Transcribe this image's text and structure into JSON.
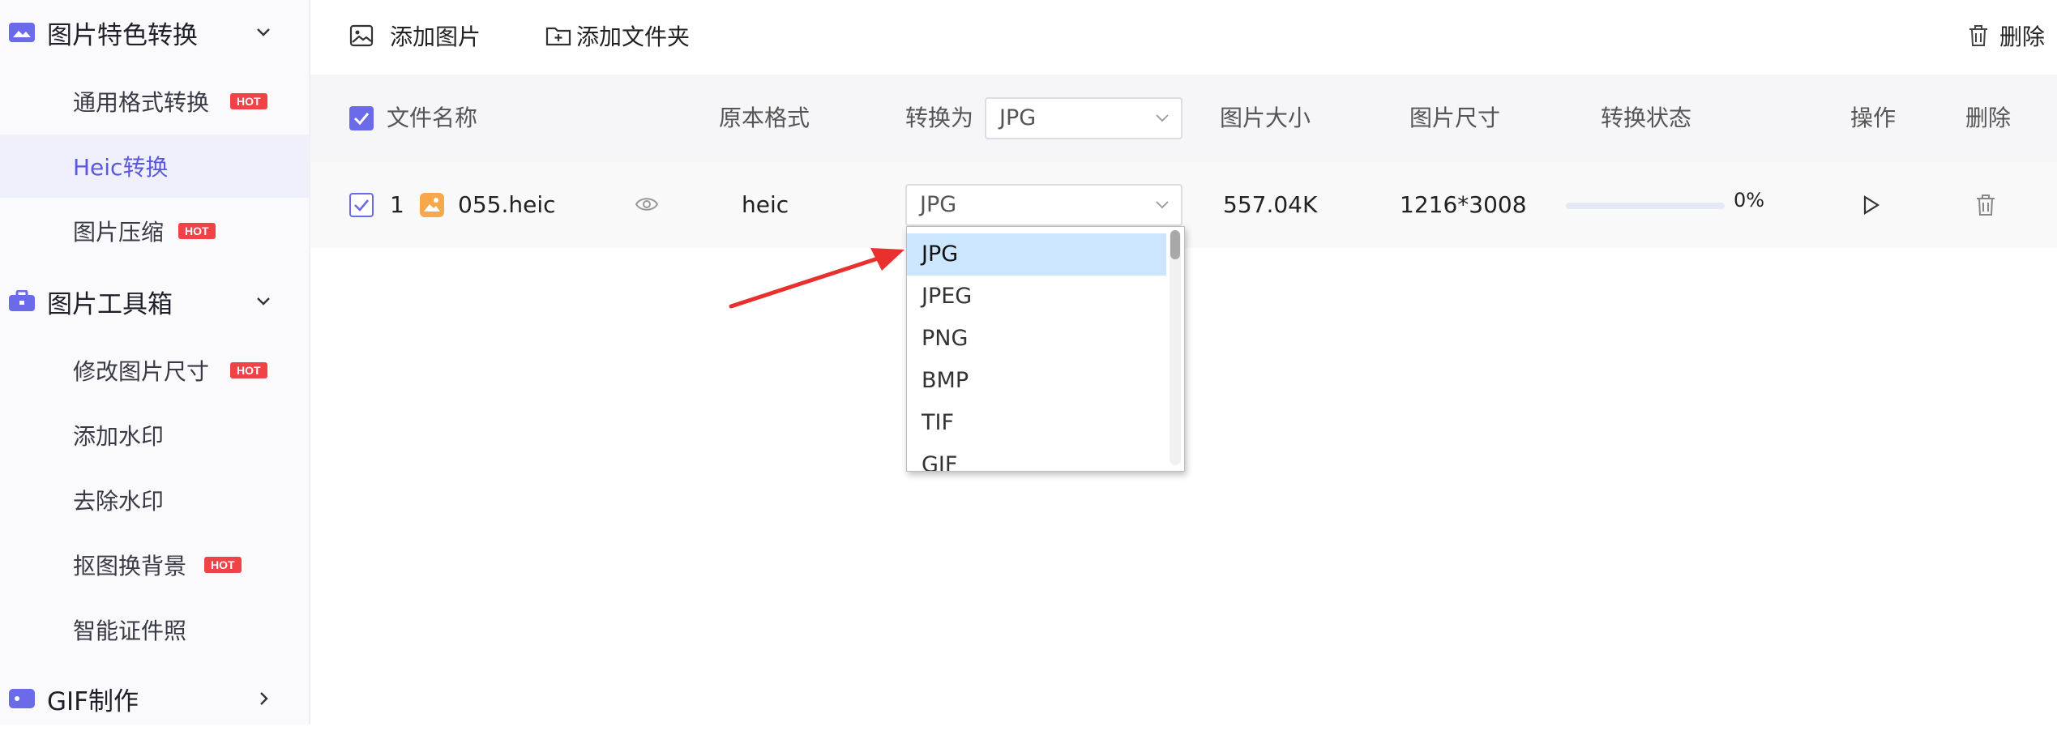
{
  "colors": {
    "accent": "#6b6ae8",
    "hot": "#f04348",
    "active_bg": "#eff0fb",
    "option_selected": "#cce6ff",
    "arrow": "#e8302e"
  },
  "sidebar": {
    "groups": [
      {
        "label": "图片特色转换",
        "icon": "image-convert-icon",
        "chevron": "chevron-down-icon"
      },
      {
        "label": "图片工具箱",
        "icon": "toolbox-icon",
        "chevron": "chevron-down-icon"
      },
      {
        "label": "GIF制作",
        "icon": "gif-icon",
        "chevron": "chevron-right-icon"
      }
    ],
    "items": [
      {
        "label": "通用格式转换",
        "badge": "HOT"
      },
      {
        "label": "Heic转换",
        "badge": "",
        "active": true
      },
      {
        "label": "图片压缩",
        "badge": "HOT"
      },
      {
        "label": "修改图片尺寸",
        "badge": "HOT"
      },
      {
        "label": "添加水印",
        "badge": ""
      },
      {
        "label": "去除水印",
        "badge": ""
      },
      {
        "label": "抠图换背景",
        "badge": "HOT"
      },
      {
        "label": "智能证件照",
        "badge": ""
      }
    ]
  },
  "toolbar": {
    "add_image": "添加图片",
    "add_folder": "添加文件夹",
    "delete": "删除"
  },
  "table": {
    "headers": {
      "filename": "文件名称",
      "original_format": "原本格式",
      "convert_to": "转换为",
      "convert_to_value": "JPG",
      "size": "图片大小",
      "dimensions": "图片尺寸",
      "status": "转换状态",
      "action": "操作",
      "delete": "删除"
    },
    "rows": [
      {
        "index": "1",
        "filename": "055.heic",
        "format": "heic",
        "target": "JPG",
        "size": "557.04K",
        "dimensions": "1216*3008",
        "progress_text": "0%",
        "progress": 0
      }
    ]
  },
  "dropdown": {
    "options": [
      "JPG",
      "JPEG",
      "PNG",
      "BMP",
      "TIF",
      "GIF"
    ],
    "selected": "JPG"
  }
}
